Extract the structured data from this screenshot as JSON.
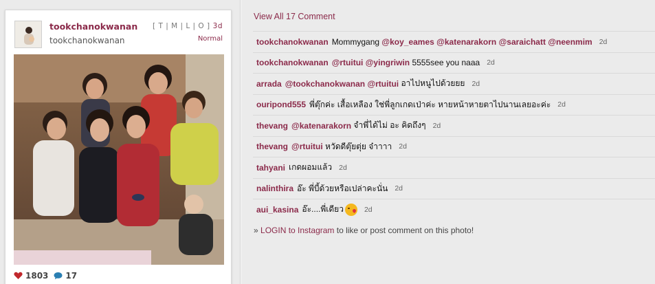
{
  "post": {
    "username": "tookchanokwanan",
    "fullname": "tookchanokwanan",
    "meta_links": "[ T | M | L | O ]",
    "age": "3d",
    "filter": "Normal",
    "likes": "1803",
    "comment_count": "17"
  },
  "comments_panel": {
    "view_all": "View All 17 Comment",
    "login_prefix": "»",
    "login_link": "LOGIN to Instagram",
    "login_suffix": "to like or post comment on this photo!"
  },
  "comments": [
    {
      "author": "tookchanokwanan",
      "parts": [
        {
          "t": "text",
          "v": "Mommygang "
        },
        {
          "t": "mention",
          "v": "@koy_eames"
        },
        {
          "t": "text",
          "v": " "
        },
        {
          "t": "mention",
          "v": "@katenarakorn"
        },
        {
          "t": "text",
          "v": " "
        },
        {
          "t": "mention",
          "v": "@saraichatt"
        },
        {
          "t": "text",
          "v": " "
        },
        {
          "t": "mention",
          "v": "@neenmim"
        }
      ],
      "time": "2d"
    },
    {
      "author": "tookchanokwanan",
      "parts": [
        {
          "t": "mention",
          "v": "@rtuitui"
        },
        {
          "t": "text",
          "v": " "
        },
        {
          "t": "mention",
          "v": "@yingriwin"
        },
        {
          "t": "text",
          "v": " 5555see you naaa"
        }
      ],
      "time": "2d"
    },
    {
      "author": "arrada",
      "parts": [
        {
          "t": "mention",
          "v": "@tookchanokwanan"
        },
        {
          "t": "text",
          "v": " "
        },
        {
          "t": "mention",
          "v": "@rtuitui"
        },
        {
          "t": "text",
          "v": " อาไปหนูไปด้วยยย"
        }
      ],
      "time": "2d"
    },
    {
      "author": "ouripond555",
      "parts": [
        {
          "t": "text",
          "v": "พี่ตุ๊กค่ะ เสื้อเหลือง ใช่พี่ลูกเกดเป่าค่ะ หายหน้าหายตาไปนานเลยอะค่ะ"
        }
      ],
      "time": "2d"
    },
    {
      "author": "thevang",
      "parts": [
        {
          "t": "mention",
          "v": "@katenarakorn"
        },
        {
          "t": "text",
          "v": " จำพี่ได้ไม่ อะ คิดถึงๆ"
        }
      ],
      "time": "2d"
    },
    {
      "author": "thevang",
      "parts": [
        {
          "t": "mention",
          "v": "@rtuitui"
        },
        {
          "t": "text",
          "v": " หวัดดีตุ๊ยตุ่ย จ๋าาาา"
        }
      ],
      "time": "2d"
    },
    {
      "author": "tahyani",
      "parts": [
        {
          "t": "text",
          "v": "เกดผอมแล้ว"
        }
      ],
      "time": "2d"
    },
    {
      "author": "nalinthira",
      "parts": [
        {
          "t": "text",
          "v": "อ๊ะ พี่บี้ด้วยหรือเปล่าคะนั่น"
        }
      ],
      "time": "2d"
    },
    {
      "author": "aui_kasina",
      "parts": [
        {
          "t": "text",
          "v": "อ๊ะ....พี่เดียว"
        },
        {
          "t": "emoji",
          "v": "kiss-emoji"
        }
      ],
      "time": "2d"
    }
  ],
  "colors": {
    "accent": "#8b2a4a",
    "heart": "#c0282d",
    "bubble": "#2a7fb3"
  }
}
